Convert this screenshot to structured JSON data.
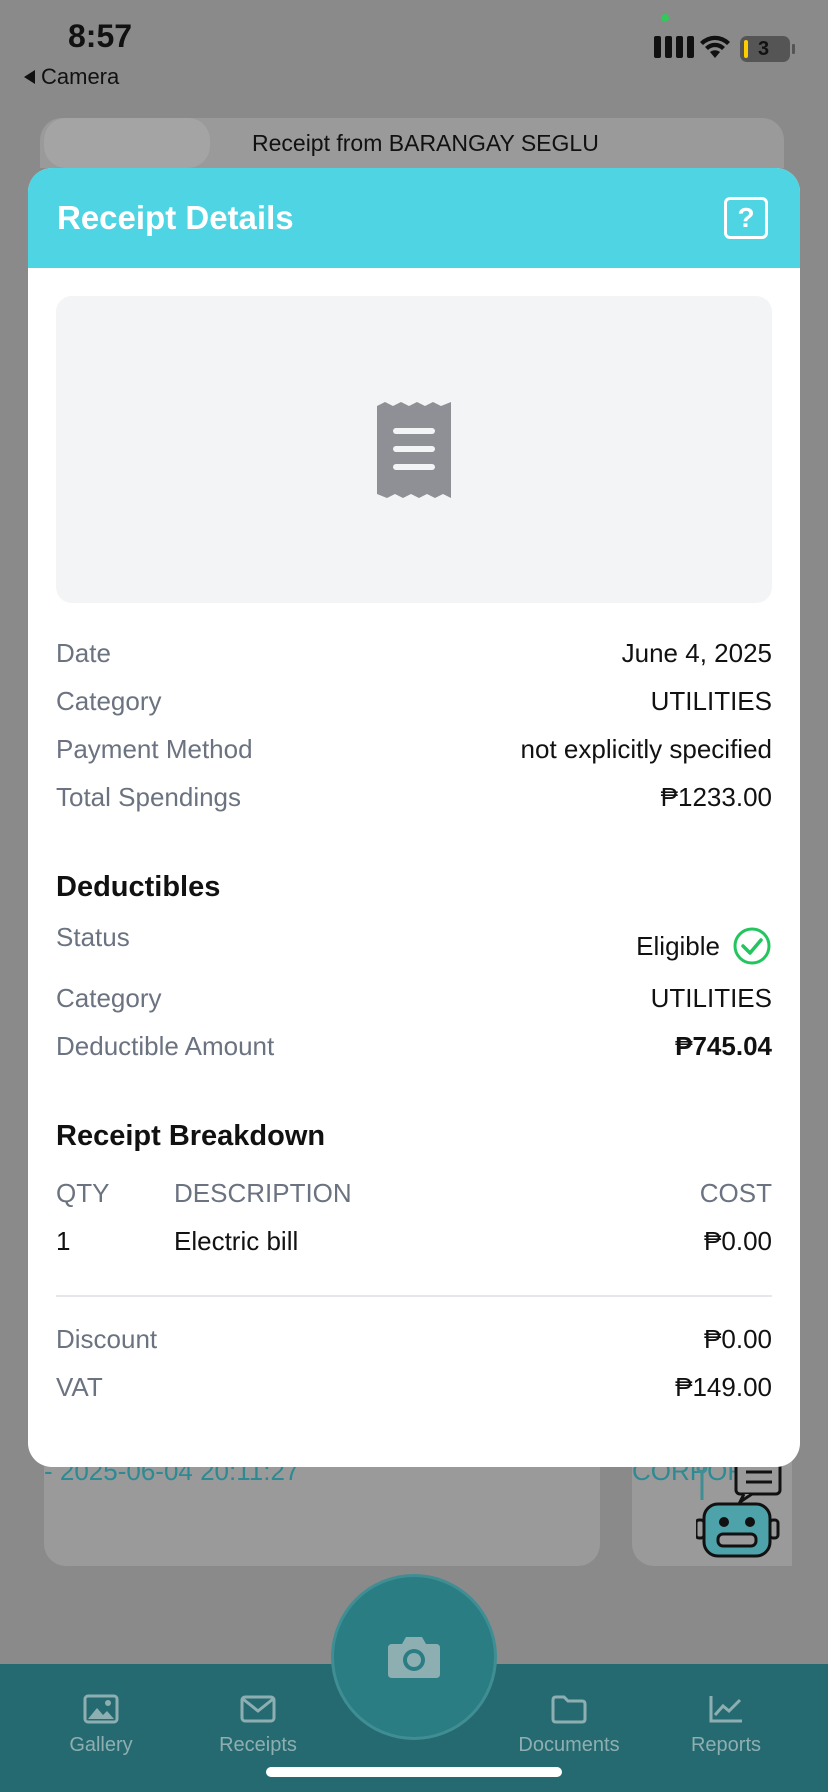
{
  "status_bar": {
    "time": "8:57",
    "back_label": "Camera",
    "battery": "3"
  },
  "background": {
    "receipt_title": "Receipt from BARANGAY SEGLU",
    "timestamp": "- 2025-06-04 20:11:27",
    "category_preview": "CORPORA"
  },
  "modal": {
    "title": "Receipt Details",
    "help_label": "?",
    "details": [
      {
        "label": "Date",
        "value": "June 4, 2025"
      },
      {
        "label": "Category",
        "value": "UTILITIES"
      },
      {
        "label": "Payment Method",
        "value": "not explicitly specified"
      },
      {
        "label": "Total Spendings",
        "value": "₱1233.00"
      }
    ],
    "deductibles": {
      "title": "Deductibles",
      "status_label": "Status",
      "status_value": "Eligible",
      "category_label": "Category",
      "category_value": "UTILITIES",
      "amount_label": "Deductible Amount",
      "amount_value": "₱745.04"
    },
    "breakdown": {
      "title": "Receipt Breakdown",
      "headers": {
        "qty": "QTY",
        "description": "DESCRIPTION",
        "cost": "COST"
      },
      "items": [
        {
          "qty": "1",
          "description": "Electric bill",
          "cost": "₱0.00"
        }
      ],
      "discount_label": "Discount",
      "discount_value": "₱0.00",
      "vat_label": "VAT",
      "vat_value": "₱149.00"
    }
  },
  "bottom_nav": {
    "items": [
      {
        "label": "Gallery",
        "icon": "image-icon"
      },
      {
        "label": "Receipts",
        "icon": "envelope-icon"
      },
      {
        "label": "Documents",
        "icon": "folder-icon"
      },
      {
        "label": "Reports",
        "icon": "chart-icon"
      }
    ]
  },
  "colors": {
    "header": "#4ed4e3",
    "eligible": "#22c55e",
    "nav": "#256a70"
  }
}
